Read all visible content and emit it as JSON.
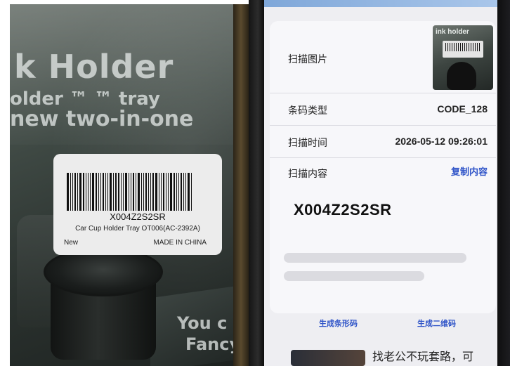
{
  "product_photo": {
    "deco_lines": [
      "k Holder",
      "older ™ ™ tray",
      "new two-in-one",
      "You c",
      "Fancy"
    ],
    "label": {
      "code": "X004Z2S2SR",
      "description": "Car Cup Holder Tray OT006(AC-2392A)",
      "condition": "New",
      "origin": "MADE IN CHINA"
    },
    "thumb_text": "ink holder"
  },
  "scan_result": {
    "image_label": "扫描图片",
    "type_label": "条码类型",
    "type_value": "CODE_128",
    "time_label": "扫描时间",
    "time_value": "2026-05-12 09:26:01",
    "content_label": "扫描内容",
    "copy_button": "复制内容",
    "content_value": "X004Z2S2SR"
  },
  "actions": {
    "generate_barcode": "生成条形码",
    "generate_qrcode": "生成二维码"
  },
  "feed": {
    "headline": "找老公不玩套路，可"
  },
  "colors": {
    "accent": "#2f54c8",
    "card": "#f7f7fa",
    "screen": "#eeeef2"
  }
}
